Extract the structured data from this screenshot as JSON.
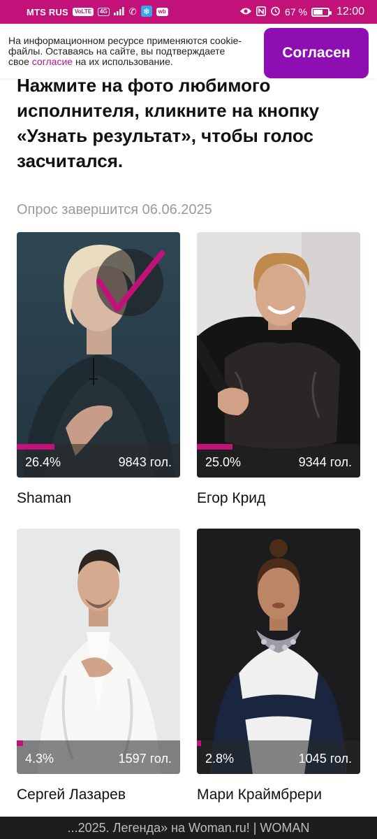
{
  "status_bar": {
    "carrier": "MTS RUS",
    "volte": "VoLTE",
    "net": "4G",
    "wb": "wb",
    "battery": "67 %",
    "battery_level": 0.67,
    "time": "12:00",
    "icons": [
      "signal-icon",
      "wifi-calling-icon",
      "snowflake-icon",
      "eye-icon",
      "nfc-icon",
      "alarm-icon",
      "battery-icon"
    ]
  },
  "cookie_banner": {
    "text_before": "На информационном ресурсе применяются cookie-файлы. Оставаясь на сайте, вы подтверждаете свое ",
    "link": "согласие",
    "text_after": " на их использование.",
    "button": "Согласен",
    "button_color": "#8e0fb1"
  },
  "poll": {
    "instruction": "Нажмите на фото любимого исполнителя, кликните на кнопку «Узнать результат», чтобы голос засчитался.",
    "deadline": "Опрос завершится 06.06.2025",
    "accent_color": "#c2127a",
    "candidates": [
      {
        "name": "Shaman",
        "percent": "26.4%",
        "share": 0.264,
        "votes": "9843 гол.",
        "selected": true
      },
      {
        "name": "Егор Крид",
        "percent": "25.0%",
        "share": 0.25,
        "votes": "9344 гол.",
        "selected": false
      },
      {
        "name": "Сергей Лазарев",
        "percent": "4.3%",
        "share": 0.043,
        "votes": "1597 гол.",
        "selected": false
      },
      {
        "name": "Мари Краймбрери",
        "percent": "2.8%",
        "share": 0.028,
        "votes": "1045 гол.",
        "selected": false
      }
    ]
  },
  "page_title_bar": "...2025. Легенда» на Woman.ru! | WOMAN"
}
